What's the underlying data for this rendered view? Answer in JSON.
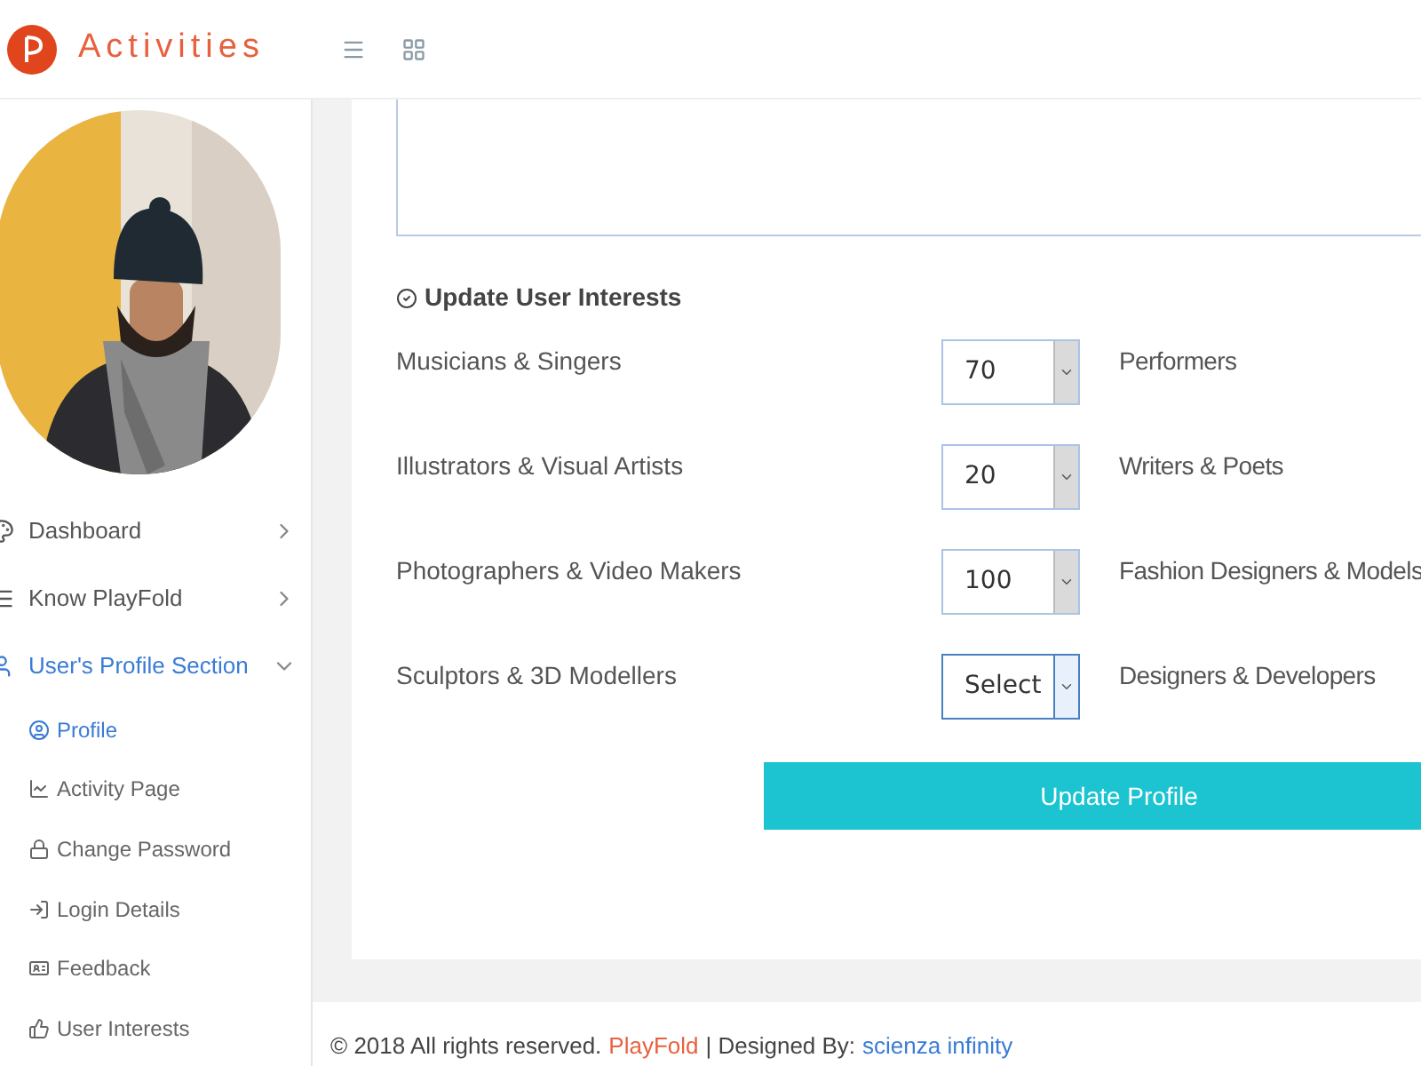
{
  "header": {
    "brand": "Activities"
  },
  "sidebar": {
    "items": [
      {
        "label": "Dashboard",
        "expanded": false,
        "selected": false
      },
      {
        "label": "Know PlayFold",
        "expanded": false,
        "selected": false
      },
      {
        "label": "User's Profile Section",
        "expanded": true,
        "selected": true,
        "children": [
          {
            "label": "Profile",
            "selected": true
          },
          {
            "label": "Activity Page",
            "selected": false
          },
          {
            "label": "Change Password",
            "selected": false
          },
          {
            "label": "Login Details",
            "selected": false
          },
          {
            "label": "Feedback",
            "selected": false
          },
          {
            "label": "User Interests",
            "selected": false
          }
        ]
      }
    ]
  },
  "section_title": "Update User Interests",
  "interests": [
    {
      "left": {
        "label": "Musicians & Singers",
        "value": "70",
        "focused": false
      },
      "right": {
        "label": "Performers"
      }
    },
    {
      "left": {
        "label": "Illustrators & Visual Artists",
        "value": "20",
        "focused": false
      },
      "right": {
        "label": "Writers & Poets"
      }
    },
    {
      "left": {
        "label": "Photographers & Video Makers",
        "value": "100",
        "focused": false
      },
      "right": {
        "label": "Fashion Designers & Models"
      }
    },
    {
      "left": {
        "label": "Sculptors & 3D Modellers",
        "value": "Select",
        "focused": true
      },
      "right": {
        "label": "Designers & Developers"
      }
    }
  ],
  "update_button": "Update Profile",
  "footer": {
    "text": "© 2018 All rights reserved.",
    "link": "PlayFold",
    "designed": "| Designed By:",
    "designer": "scienza infinity"
  }
}
